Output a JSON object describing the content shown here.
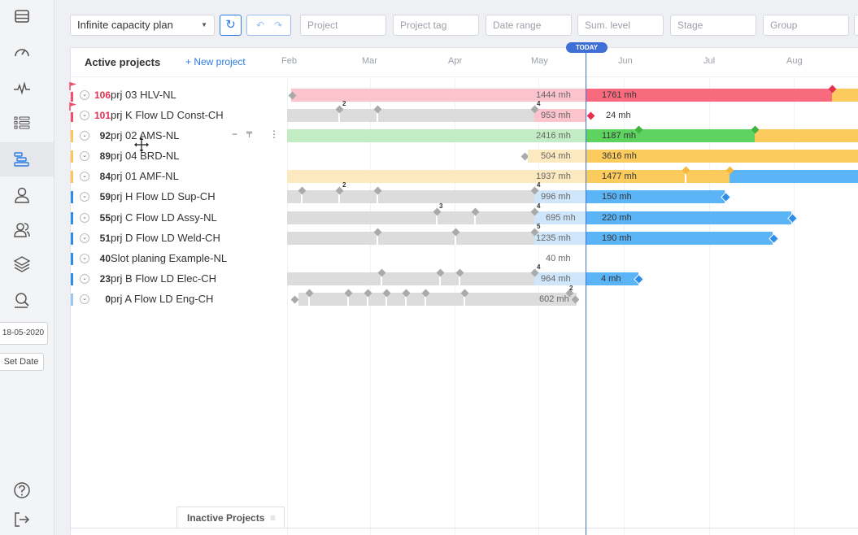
{
  "sidebar": {
    "date_value": "18-05-2020",
    "set_date_label": "Set Date",
    "icons": [
      "list-icon",
      "gauge-icon",
      "activity-icon",
      "task-list-icon",
      "gantt-icon",
      "user-icon",
      "users-icon",
      "layers-icon",
      "search-people-icon",
      "help-icon",
      "logout-icon"
    ]
  },
  "toolbar": {
    "plan_select": "Infinite capacity plan",
    "refresh_icon": "↻",
    "undo_icon": "↶",
    "redo_icon": "↷",
    "filters": {
      "project": "Project",
      "project_tag": "Project tag",
      "date_range": "Date range",
      "sum_level": "Sum. level",
      "stage": "Stage",
      "group": "Group"
    }
  },
  "panel": {
    "title": "Active projects",
    "new_project": "+  New project",
    "today_label": "TODAY",
    "months": [
      "Feb",
      "Mar",
      "Apr",
      "May",
      "Jun",
      "Jul",
      "Aug"
    ],
    "inactive_tab": "Inactive Projects",
    "tab_menu_icon": "≡"
  },
  "projects": [
    {
      "priority": "106",
      "name": "prj 03 HLV-NL",
      "flag": true,
      "color": "#f0506e",
      "past_mh": "1444 mh",
      "future_mh": "1761 mh"
    },
    {
      "priority": "101",
      "name": "prj K Flow LD Const-CH",
      "flag": true,
      "color": "#f0506e",
      "past_mh": "953 mh",
      "future_mh": "24 mh",
      "ms_count_a": "2",
      "ms_count_b": "4"
    },
    {
      "priority": "92",
      "name": "prj 02 AMS-NL",
      "flag": false,
      "color": "#f8c85c",
      "past_mh": "2416 mh",
      "future_mh": "1187 mh",
      "tools": "−  ⫶⃝  ⋮"
    },
    {
      "priority": "89",
      "name": "prj 04 BRD-NL",
      "flag": false,
      "color": "#f8c85c",
      "past_mh": "504 mh",
      "future_mh": "3616 mh"
    },
    {
      "priority": "84",
      "name": "prj 01 AMF-NL",
      "flag": false,
      "color": "#f8c85c",
      "past_mh": "1937 mh",
      "future_mh": "1477 mh"
    },
    {
      "priority": "59",
      "name": "prj H Flow LD Sup-CH",
      "flag": false,
      "color": "#2d8ee8",
      "past_mh": "996 mh",
      "future_mh": "150 mh",
      "ms_count_a": "2",
      "ms_count_b": "4"
    },
    {
      "priority": "55",
      "name": "prj C Flow LD Assy-NL",
      "flag": false,
      "color": "#2d8ee8",
      "past_mh": "695 mh",
      "future_mh": "220 mh",
      "ms_count_a": "3",
      "ms_count_b": "4"
    },
    {
      "priority": "51",
      "name": "prj D Flow LD Weld-CH",
      "flag": false,
      "color": "#2d8ee8",
      "past_mh": "1235 mh",
      "future_mh": "190 mh",
      "ms_count_b": "5"
    },
    {
      "priority": "40",
      "name": "Slot planing Example-NL",
      "flag": false,
      "color": "#2d8ee8",
      "past_mh": "40 mh",
      "future_mh": ""
    },
    {
      "priority": "23",
      "name": "prj B Flow LD Elec-CH",
      "flag": false,
      "color": "#2d8ee8",
      "past_mh": "964 mh",
      "future_mh": "4 mh",
      "ms_count_b": "4"
    },
    {
      "priority": "0",
      "name": "prj A Flow LD Eng-CH",
      "flag": false,
      "color": "#9cc7f0",
      "past_mh": "602 mh",
      "future_mh": "",
      "ms_count_b": "2"
    }
  ]
}
